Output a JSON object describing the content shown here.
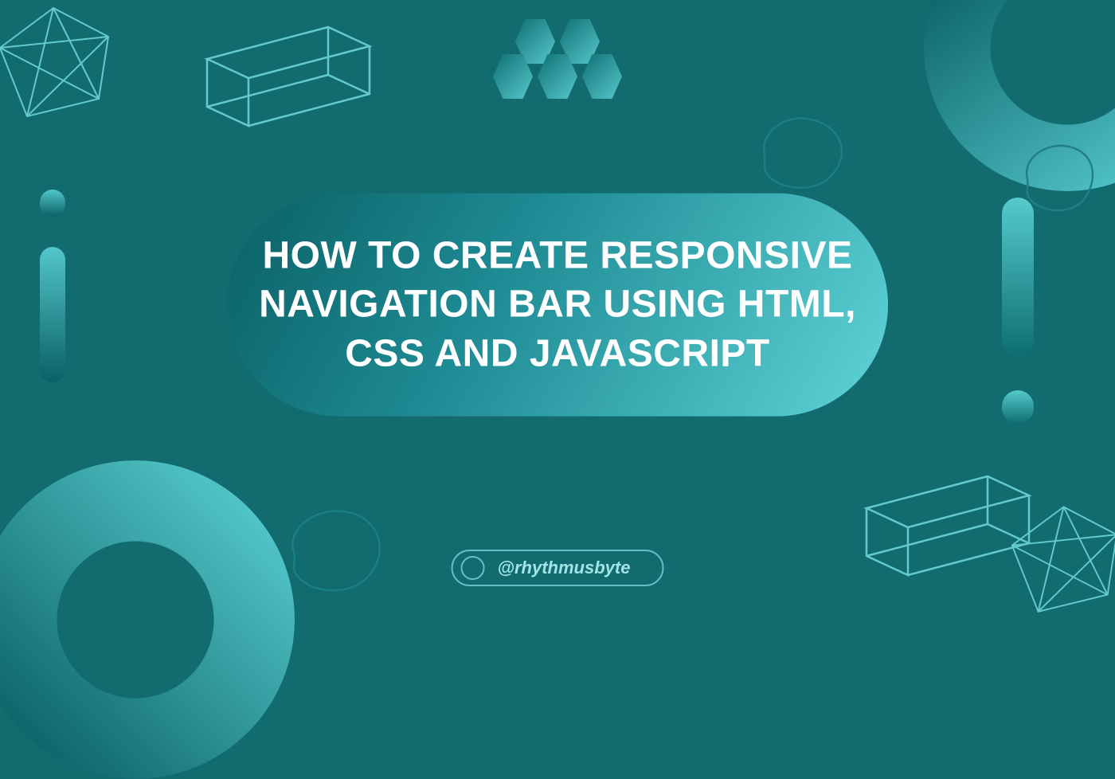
{
  "title": "HOW  TO CREATE RESPONSIVE NAVIGATION BAR USING HTML, CSS AND JAVASCRIPT",
  "handle": "@rhythmusbyte"
}
